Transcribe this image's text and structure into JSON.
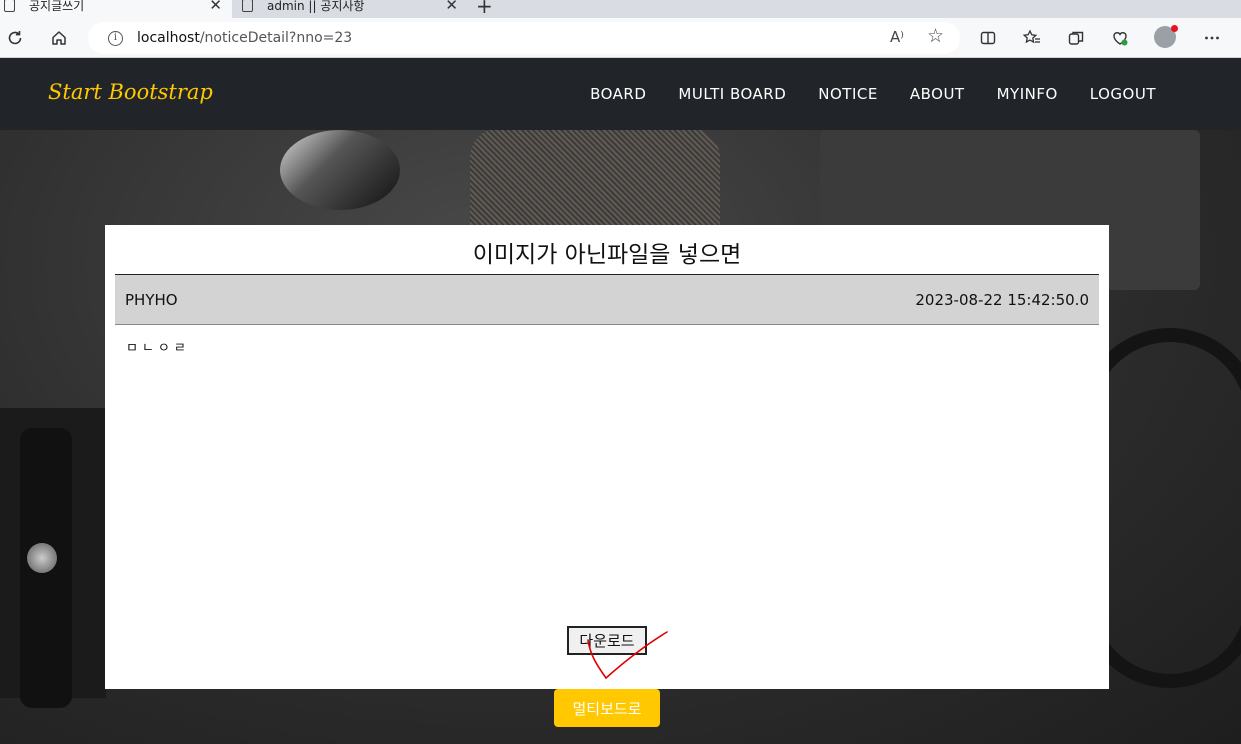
{
  "browser": {
    "tabs": [
      {
        "title": "공지글쓰기",
        "active": true
      },
      {
        "title": "admin || 공지사항",
        "active": false
      }
    ],
    "close_glyph": "✕",
    "newtab_glyph": "+",
    "url_host": "localhost",
    "url_path": "/noticeDetail?nno=23",
    "read_aloud_glyph": "A⁾",
    "icons": [
      "refresh-icon",
      "home-icon",
      "info-icon",
      "read-aloud-icon",
      "favorite-star-icon",
      "split-screen-icon",
      "favorites-icon",
      "collections-icon",
      "browser-essentials-icon",
      "profile-avatar",
      "more-icon"
    ]
  },
  "site": {
    "brand": "Start Bootstrap",
    "nav": [
      "BOARD",
      "MULTI BOARD",
      "NOTICE",
      "ABOUT",
      "MYINFO",
      "LOGOUT"
    ]
  },
  "post": {
    "title": "이미지가 아닌파일을 넣으면",
    "author": "PHYHO",
    "date": "2023-08-22 15:42:50.0",
    "content": "ㅁㄴㅇㄹ",
    "download_label": "다운로드"
  },
  "footer_button": "멀티보드로",
  "colors": {
    "accent": "#ffc800",
    "navbar": "#212529",
    "annotation": "#e00000"
  }
}
